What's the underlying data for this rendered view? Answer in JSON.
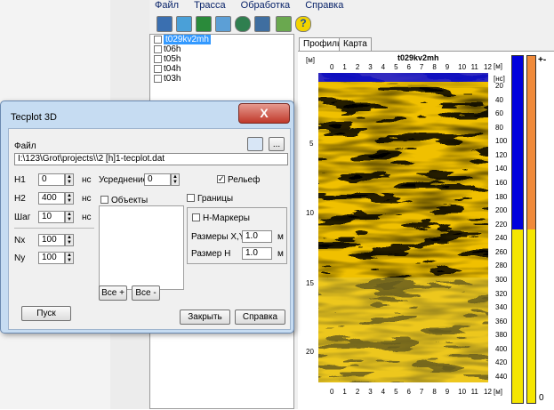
{
  "menu": [
    "Файл",
    "Трасса",
    "Обработка",
    "Справка"
  ],
  "toolbar_icons": [
    "open-icon",
    "save-icon",
    "chart-icon",
    "refresh-icon",
    "route-icon",
    "settings-icon",
    "monitor-icon",
    "help-icon"
  ],
  "files": [
    "t029kv2mh",
    "t06h",
    "t05h",
    "t04h",
    "t03h"
  ],
  "tabs": {
    "profile": "Профиль",
    "map": "Карта"
  },
  "radargram": {
    "title": "t029kv2mh",
    "top_ticks": [
      "0",
      "1",
      "2",
      "3",
      "4",
      "5",
      "6",
      "7",
      "8",
      "9",
      "10",
      "11",
      "12"
    ],
    "left_unit": "[м]",
    "left_ticks": [
      "5",
      "10",
      "15",
      "20"
    ],
    "right_unit_top": "[м]",
    "right_unit_ns": "[нс]",
    "right_ticks": [
      "20",
      "40",
      "60",
      "80",
      "100",
      "120",
      "140",
      "160",
      "180",
      "200",
      "220",
      "240",
      "260",
      "280",
      "300",
      "320",
      "340",
      "360",
      "380",
      "400",
      "420",
      "440"
    ],
    "bottom_ticks": [
      "0",
      "1",
      "2",
      "3",
      "4",
      "5",
      "6",
      "7",
      "8",
      "9",
      "10",
      "11",
      "12"
    ],
    "bottom_unit": "[м]",
    "scale_labels": [
      "[м]",
      "[нс]"
    ],
    "bar_top_label": "0",
    "side_marker": "+-",
    "bottom_marker": "0",
    "scale_bar_top_fraction": 0.5
  },
  "dialog": {
    "title": "Tecplot 3D",
    "file_label": "Файл",
    "file_path": "I:\\123\\Grot\\projects\\\\2 [h]1-tecplot.dat",
    "browse_button": "...",
    "h1_label": "H1",
    "h1_value": "0",
    "h1_unit": "нс",
    "h2_label": "H2",
    "h2_value": "400",
    "h2_unit": "нс",
    "step_label": "Шаг",
    "step_value": "10",
    "step_unit": "нс",
    "nx_label": "Nx",
    "nx_value": "100",
    "ny_label": "Ny",
    "ny_value": "100",
    "avg_label": "Усреднение",
    "avg_value": "0",
    "relief_label": "Рельеф",
    "objects_label": "Объекты",
    "bounds_label": "Границы",
    "hmarkers_label": "Н-Маркеры",
    "sizexy_label": "Размеры X,Y",
    "sizexy_value": "1.0",
    "sizexy_unit": "м",
    "sizeh_label": "Размер Н",
    "sizeh_value": "1.0",
    "sizeh_unit": "м",
    "all_plus": "Все +",
    "all_minus": "Все -",
    "start_button": "Пуск",
    "close_button": "Закрыть",
    "help_button": "Справка",
    "close_x": "X"
  }
}
